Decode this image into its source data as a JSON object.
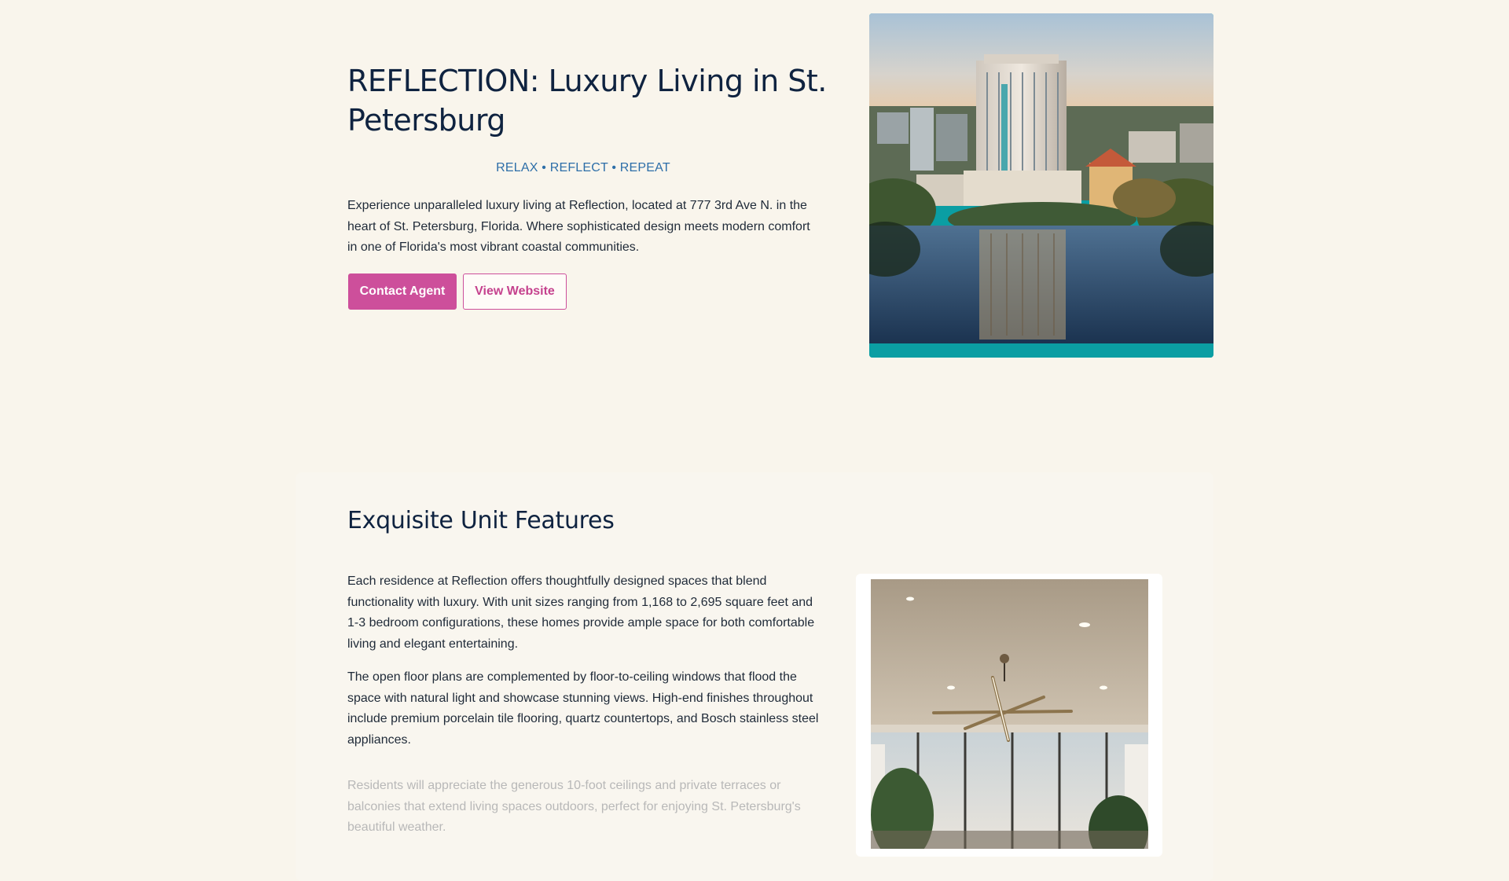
{
  "hero": {
    "title": "REFLECTION: Luxury Living in St. Petersburg",
    "tagline": "RELAX • REFLECT • REPEAT",
    "description": "Experience unparalleled luxury living at Reflection, located at 777 3rd Ave N. in the heart of St. Petersburg, Florida. Where sophisticated design meets modern comfort in one of Florida's most vibrant coastal communities.",
    "contact_label": "Contact Agent",
    "website_label": "View Website"
  },
  "features": {
    "title": "Exquisite Unit Features",
    "paragraphs": [
      "Each residence at Reflection offers thoughtfully designed spaces that blend functionality with luxury. With unit sizes ranging from 1,168 to 2,695 square feet and 1-3 bedroom configurations, these homes provide ample space for both comfortable living and elegant entertaining.",
      "The open floor plans are complemented by floor-to-ceiling windows that flood the space with natural light and showcase stunning views. High-end finishes throughout include premium porcelain tile flooring, quartz countertops, and Bosch stainless steel appliances.",
      "Residents will appreciate the generous 10-foot ceilings and private terraces or balconies that extend living spaces outdoors, perfect for enjoying St. Petersburg's beautiful weather."
    ]
  },
  "colors": {
    "background": "#f9f5ec",
    "accent_pink": "#cd4f9b",
    "tagline_blue": "#2d6ea8",
    "heading_navy": "#0f2340",
    "teal_strip": "#0b9ea3"
  }
}
